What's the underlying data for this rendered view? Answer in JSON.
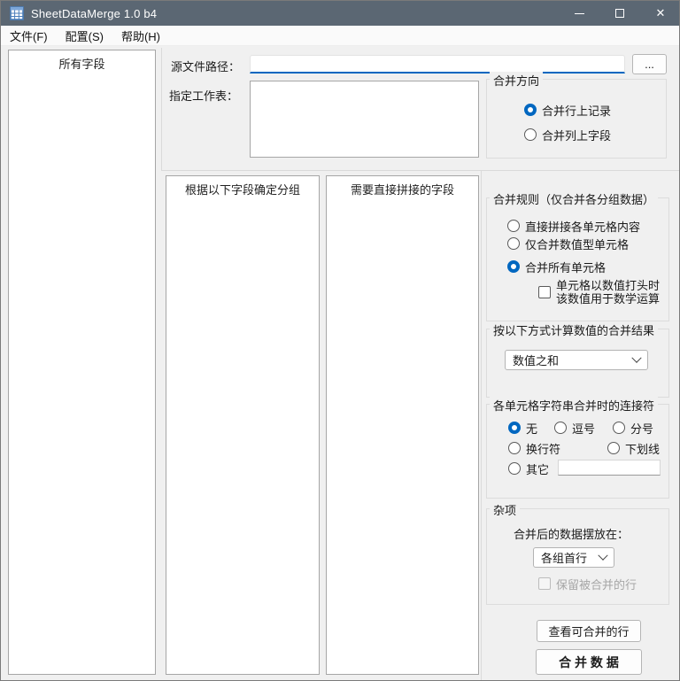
{
  "window": {
    "title": "SheetDataMerge 1.0 b4",
    "close_glyph": "✕"
  },
  "menu": {
    "file": "文件(F)",
    "config": "配置(S)",
    "help": "帮助(H)"
  },
  "left_panel": {
    "header": "所有字段"
  },
  "source": {
    "label": "源文件路径：",
    "value": "",
    "browse_label": "..."
  },
  "worksheet": {
    "label": "指定工作表："
  },
  "direction_group": {
    "title": "合并方向",
    "options": [
      {
        "label": "合并行上记录",
        "selected": true
      },
      {
        "label": "合并列上字段",
        "selected": false
      }
    ]
  },
  "group_fields_box": {
    "header": "根据以下字段确定分组"
  },
  "concat_fields_box": {
    "header": "需要直接拼接的字段"
  },
  "rules_group": {
    "title": "合并规则（仅合并各分组数据）",
    "options": [
      {
        "label": "直接拼接各单元格内容",
        "selected": false
      },
      {
        "label": "仅合并数值型单元格",
        "selected": false
      },
      {
        "label": "合并所有单元格",
        "selected": true
      }
    ],
    "numeric_checkbox": {
      "line1": "单元格以数值打头时",
      "line2": "该数值用于数学运算",
      "checked": false
    }
  },
  "calc_group": {
    "title": "按以下方式计算数值的合并结果",
    "dropdown_value": "数值之和"
  },
  "connector_group": {
    "title": "各单元格字符串合并时的连接符",
    "options": [
      {
        "label": "无",
        "selected": true
      },
      {
        "label": "逗号",
        "selected": false
      },
      {
        "label": "分号",
        "selected": false
      },
      {
        "label": "换行符",
        "selected": false
      },
      {
        "label": "下划线",
        "selected": false
      },
      {
        "label": "其它",
        "selected": false
      }
    ],
    "other_value": ""
  },
  "misc_group": {
    "title": "杂项",
    "place_label": "合并后的数据摆放在：",
    "dropdown_value": "各组首行",
    "keep_checkbox": {
      "label": "保留被合并的行",
      "checked": false,
      "disabled": true
    }
  },
  "actions": {
    "view_button": "查看可合并的行",
    "merge_button": "合 并 数 据"
  },
  "colors": {
    "titlebar": "#5b6773",
    "accent": "#0067c0",
    "client_bg": "#f0f0f0"
  }
}
